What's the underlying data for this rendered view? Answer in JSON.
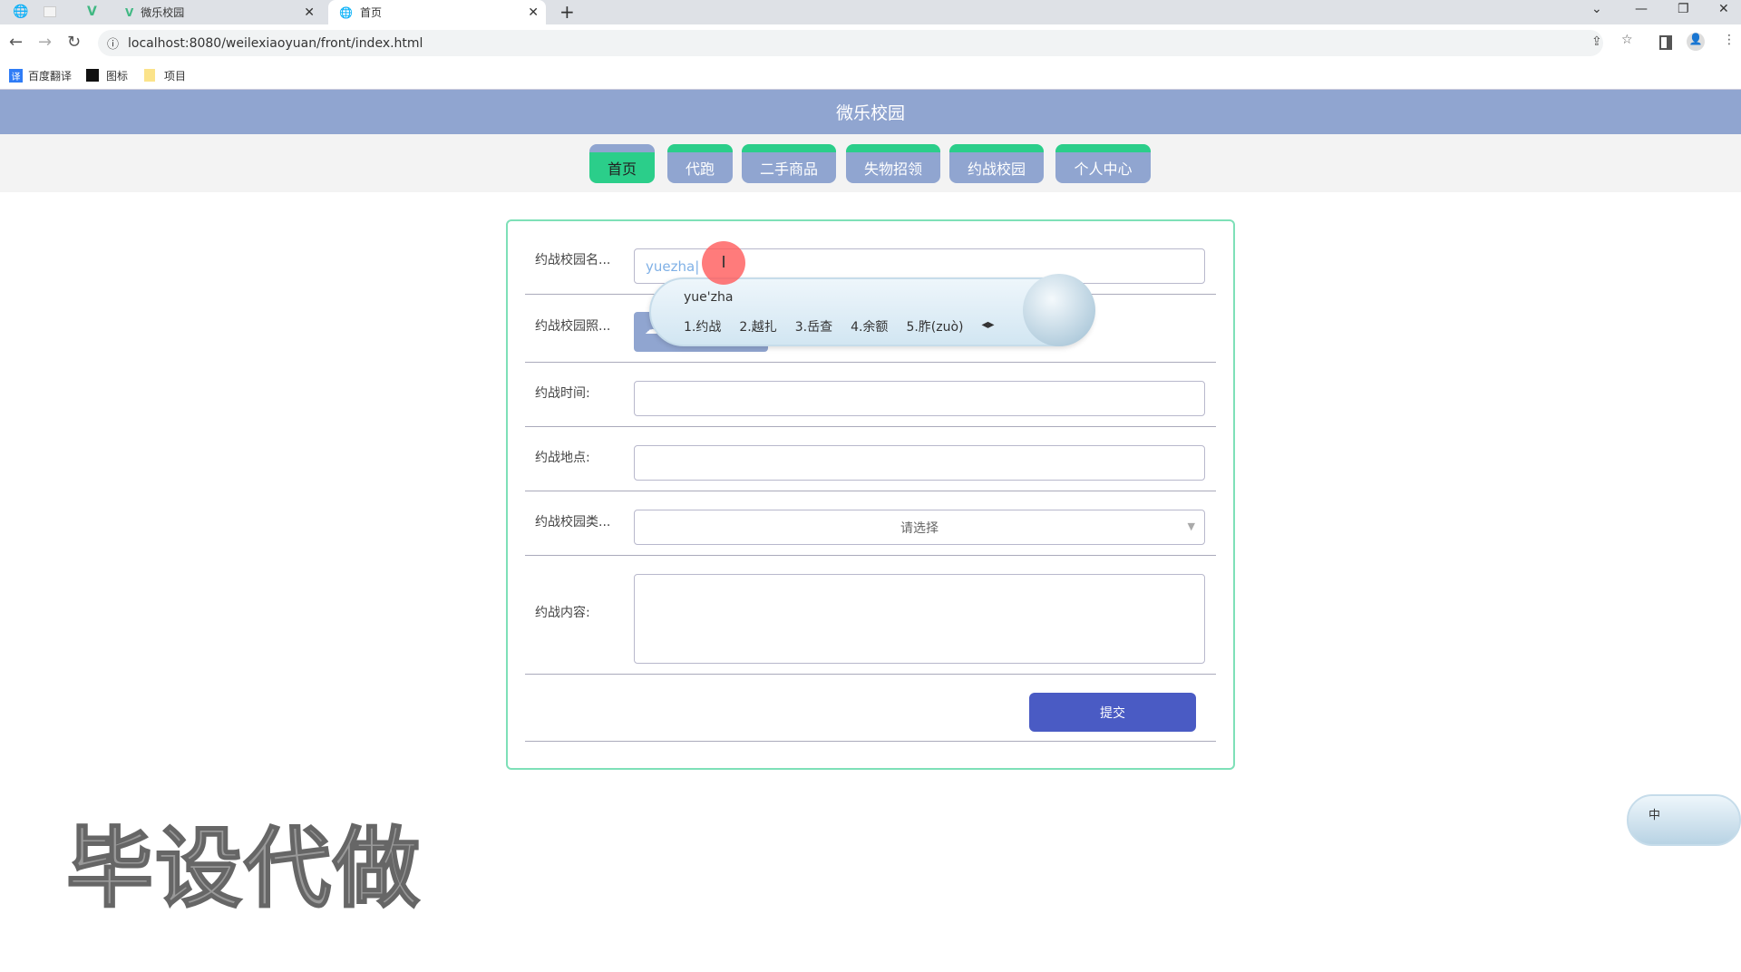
{
  "browser": {
    "tabs": [
      {
        "title": "微乐校园",
        "icon": "vue-icon"
      },
      {
        "title": "首页",
        "icon": "globe-icon",
        "active": true
      }
    ],
    "url": "localhost:8080/weilexiaoyuan/front/index.html",
    "bookmarks": [
      {
        "label": "百度翻译",
        "icon": "translate-icon"
      },
      {
        "label": "图标",
        "icon": "flag-icon"
      },
      {
        "label": "项目",
        "icon": "folder-icon"
      }
    ]
  },
  "header": {
    "title": "微乐校园"
  },
  "nav": {
    "items": [
      {
        "label": "首页",
        "active": true
      },
      {
        "label": "代跑"
      },
      {
        "label": "二手商品"
      },
      {
        "label": "失物招领"
      },
      {
        "label": "约战校园"
      },
      {
        "label": "个人中心"
      }
    ]
  },
  "form": {
    "name_label": "约战校园名...",
    "name_value": "yuezha",
    "photo_label": "约战校园照...",
    "time_label": "约战时间:",
    "place_label": "约战地点:",
    "type_label": "约战校园类...",
    "type_placeholder": "请选择",
    "content_label": "约战内容:",
    "submit": "提交"
  },
  "ime": {
    "composition": "yue'zha",
    "candidates": [
      "1.约战",
      "2.越扎",
      "3.岳查",
      "4.余额",
      "5.胙(zuò)"
    ],
    "status": "中"
  },
  "watermark": "毕设代做",
  "colors": {
    "header": "#90a5d0",
    "accent": "#2bce8a",
    "submit": "#4a5bc4"
  }
}
